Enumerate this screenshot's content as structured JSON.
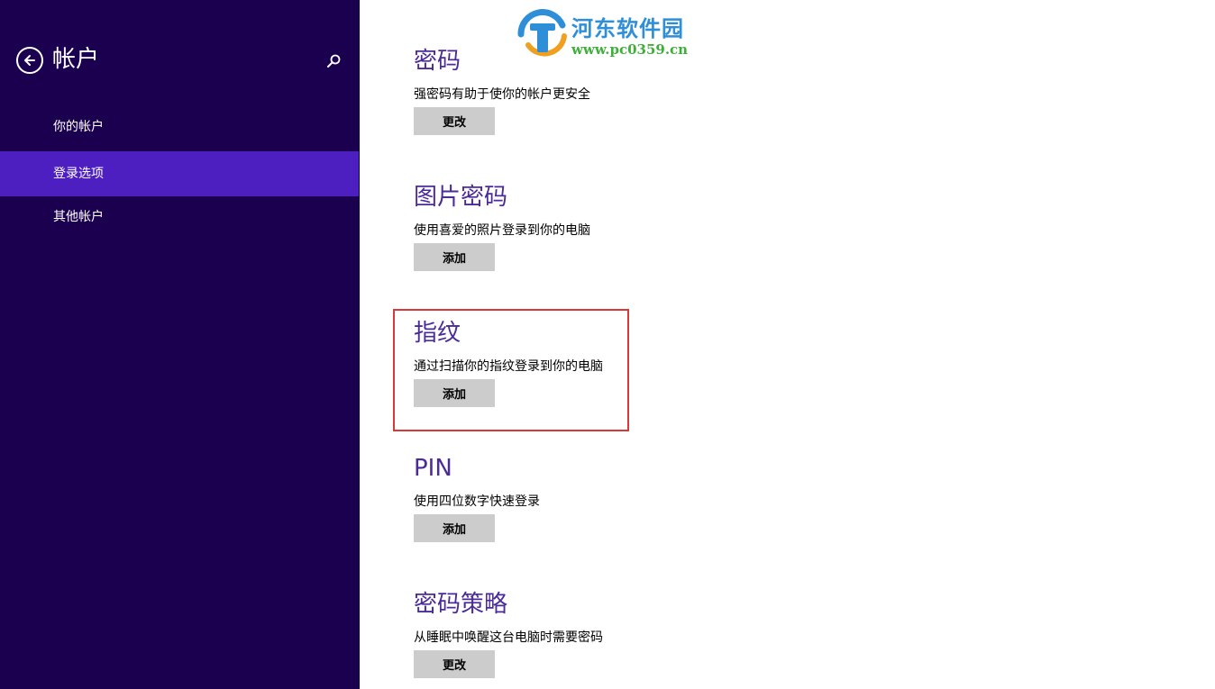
{
  "sidebar": {
    "title": "帐户",
    "items": [
      {
        "label": "你的帐户",
        "active": false
      },
      {
        "label": "登录选项",
        "active": true
      },
      {
        "label": "其他帐户",
        "active": false
      }
    ]
  },
  "sections": [
    {
      "title": "密码",
      "description": "强密码有助于使你的帐户更安全",
      "button": "更改"
    },
    {
      "title": "图片密码",
      "description": "使用喜爱的照片登录到你的电脑",
      "button": "添加"
    },
    {
      "title": "指纹",
      "description": "通过扫描你的指纹登录到你的电脑",
      "button": "添加"
    },
    {
      "title": "PIN",
      "description": "使用四位数字快速登录",
      "button": "添加"
    },
    {
      "title": "密码策略",
      "description": "从睡眠中唤醒这台电脑时需要密码",
      "button": "更改"
    }
  ],
  "watermark": {
    "title": "河东软件园",
    "url": "www.pc0359.cn"
  },
  "colors": {
    "sidebar_bg": "#1b0050",
    "sidebar_active": "#4d1ec0",
    "heading": "#4b2a9a",
    "button_bg": "#cccccc",
    "highlight": "#d93838"
  }
}
